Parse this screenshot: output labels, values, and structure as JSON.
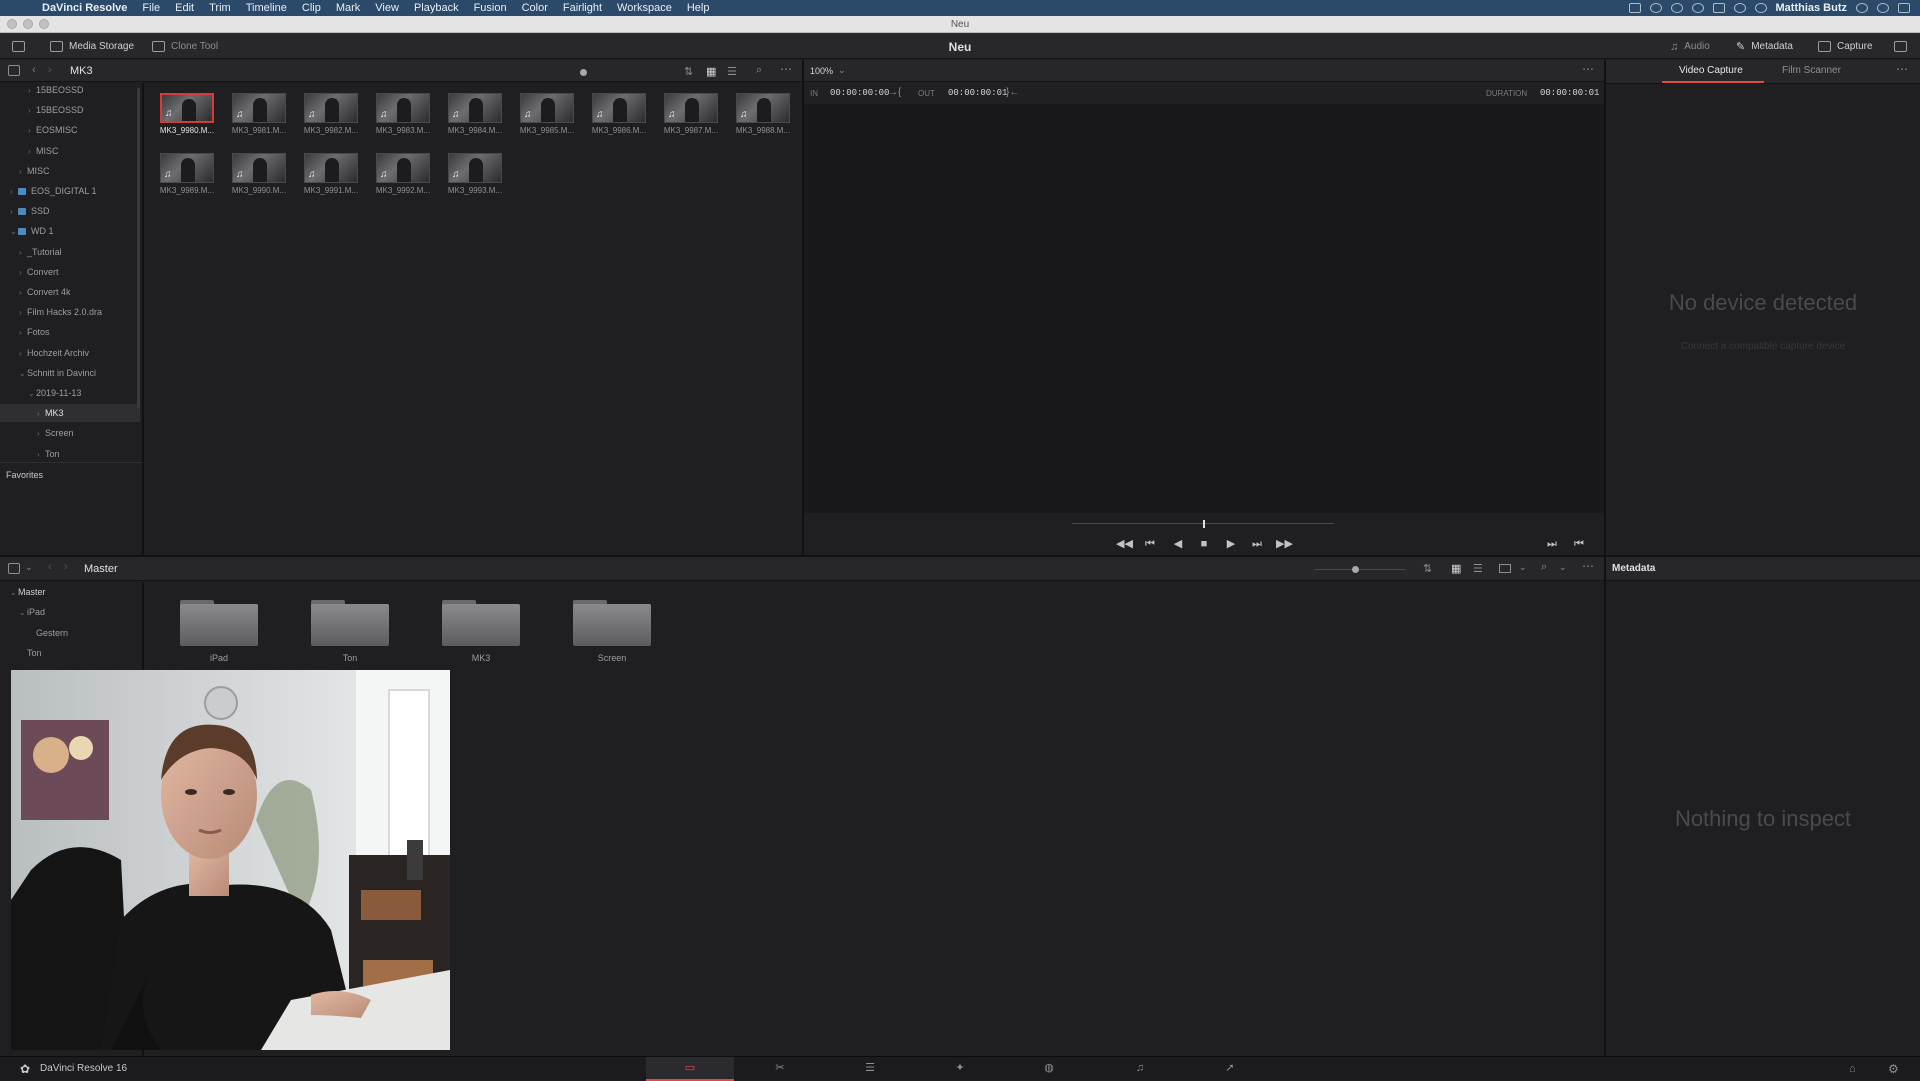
{
  "menubar": {
    "app_name": "DaVinci Resolve",
    "items": [
      "File",
      "Edit",
      "Trim",
      "Timeline",
      "Clip",
      "Mark",
      "View",
      "Playback",
      "Fusion",
      "Color",
      "Fairlight",
      "Workspace",
      "Help"
    ],
    "user": "Matthias Butz"
  },
  "window": {
    "title": "Neu"
  },
  "toolbar": {
    "media_storage": "Media Storage",
    "clone_tool": "Clone Tool",
    "project_name": "Neu",
    "audio": "Audio",
    "metadata": "Metadata",
    "capture": "Capture"
  },
  "media_storage": {
    "current_folder": "MK3",
    "zoom": "100%",
    "tree": [
      {
        "label": "15BEOSSD",
        "depth": 2,
        "chev": "›"
      },
      {
        "label": "15BEOSSD",
        "depth": 2,
        "chev": "›"
      },
      {
        "label": "EOSMISC",
        "depth": 2,
        "chev": "›"
      },
      {
        "label": "MISC",
        "depth": 2,
        "chev": "›"
      },
      {
        "label": "MISC",
        "depth": 1,
        "chev": "›"
      },
      {
        "label": "EOS_DIGITAL 1",
        "depth": 0,
        "chev": "›",
        "drive": true
      },
      {
        "label": "SSD",
        "depth": 0,
        "chev": "›",
        "drive": true
      },
      {
        "label": "WD 1",
        "depth": 0,
        "chev": "⌄",
        "drive": true
      },
      {
        "label": "_Tutorial",
        "depth": 1,
        "chev": "›"
      },
      {
        "label": "Convert",
        "depth": 1,
        "chev": "›"
      },
      {
        "label": "Convert 4k",
        "depth": 1,
        "chev": "›"
      },
      {
        "label": "Film Hacks 2.0.dra",
        "depth": 1,
        "chev": "›"
      },
      {
        "label": "Fotos",
        "depth": 1,
        "chev": "›"
      },
      {
        "label": "Hochzeit Archiv",
        "depth": 1,
        "chev": "›"
      },
      {
        "label": "Schnitt in Davinci",
        "depth": 1,
        "chev": "⌄"
      },
      {
        "label": "2019-11-13",
        "depth": 2,
        "chev": "⌄"
      },
      {
        "label": "MK3",
        "depth": 3,
        "chev": "›",
        "selected": true
      },
      {
        "label": "Screen",
        "depth": 3,
        "chev": "›"
      },
      {
        "label": "Ton",
        "depth": 3,
        "chev": "›"
      }
    ],
    "favorites_label": "Favorites",
    "clips": [
      "MK3_9980.M...",
      "MK3_9981.M...",
      "MK3_9982.M...",
      "MK3_9983.M...",
      "MK3_9984.M...",
      "MK3_9985.M...",
      "MK3_9986.M...",
      "MK3_9987.M...",
      "MK3_9988.M...",
      "MK3_9989.M...",
      "MK3_9990.M...",
      "MK3_9991.M...",
      "MK3_9992.M...",
      "MK3_9993.M..."
    ],
    "selected_clip_index": 0
  },
  "viewer": {
    "in_label": "IN",
    "in_tc": "00:00:00:00",
    "out_label": "OUT",
    "out_tc": "00:00:00:01",
    "duration_label": "DURATION",
    "duration_tc": "00:00:00:01"
  },
  "capture_panel": {
    "tabs": [
      "Video Capture",
      "Film Scanner"
    ],
    "active_tab": 0,
    "message": "No device detected",
    "sub_message": "Connect a compatible capture device"
  },
  "media_pool": {
    "current_bin": "Master",
    "tree": [
      {
        "label": "Master",
        "depth": 0,
        "chev": "⌄"
      },
      {
        "label": "iPad",
        "depth": 1,
        "chev": "⌄"
      },
      {
        "label": "Gestern",
        "depth": 2,
        "chev": ""
      },
      {
        "label": "Ton",
        "depth": 1,
        "chev": ""
      }
    ],
    "folders": [
      "iPad",
      "Ton",
      "MK3",
      "Screen"
    ]
  },
  "metadata_panel": {
    "title": "Metadata",
    "message": "Nothing to inspect"
  },
  "pagebar": {
    "app_label": "DaVinci Resolve 16",
    "pages": [
      "media-page-icon",
      "cut-page-icon",
      "edit-page-icon",
      "fusion-page-icon",
      "color-page-icon",
      "fairlight-page-icon",
      "deliver-page-icon"
    ],
    "active_page": 0
  },
  "colors": {
    "accent": "#e24a4a",
    "menubar": "#2b4a69",
    "panel_bg": "#1f1f22"
  }
}
